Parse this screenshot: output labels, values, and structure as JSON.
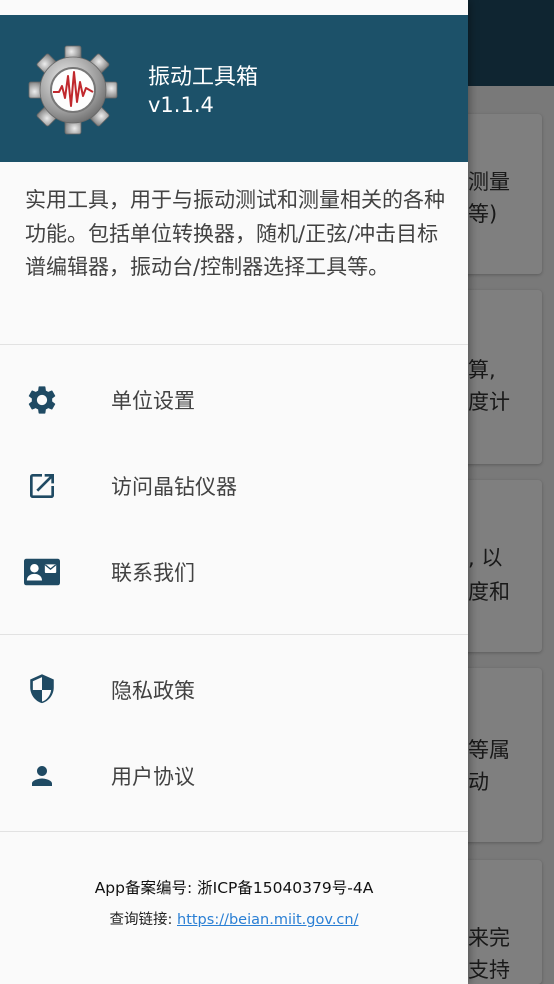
{
  "header": {
    "app_name": "振动工具箱",
    "version": "v1.1.4",
    "logo_icon": "gear-waveform-icon",
    "bg_color": "#1c5169"
  },
  "description": "实用工具，用于与振动测试和测量相关的各种功能。包括单位转换器，随机/正弦/冲击目标谱编辑器，振动台/控制器选择工具等。",
  "menu": {
    "section1": [
      {
        "label": "单位设置",
        "icon": "gear-icon"
      },
      {
        "label": "访问晶钻仪器",
        "icon": "open-external-icon"
      },
      {
        "label": "联系我们",
        "icon": "contact-card-icon"
      }
    ],
    "section2": [
      {
        "label": "隐私政策",
        "icon": "shield-icon"
      },
      {
        "label": "用户协议",
        "icon": "person-icon"
      }
    ]
  },
  "footer": {
    "record": "App备案编号: 浙ICP备15040379号-4A",
    "query_label": "查询链接: ",
    "query_link": "https://beian.miit.gov.cn/"
  },
  "background_cards": [
    {
      "lines": [
        "测量",
        "等)"
      ]
    },
    {
      "lines": [
        "算,",
        "度计"
      ]
    },
    {
      "lines": [
        ", 以",
        "度和"
      ]
    },
    {
      "lines": [
        "等属",
        "动"
      ]
    },
    {
      "lines": [
        "来完",
        "支持"
      ]
    }
  ],
  "colors": {
    "accent": "#1c5169",
    "icon": "#1f4a63",
    "link": "#2a7fd4"
  }
}
